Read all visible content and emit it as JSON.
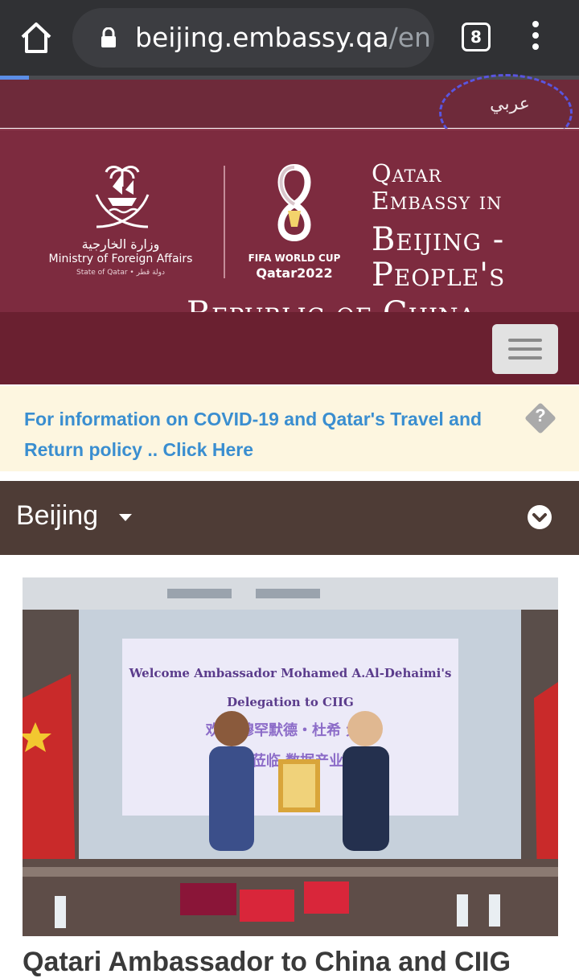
{
  "browser": {
    "url_host": "beijing.embassy.qa",
    "url_path": "/en",
    "tab_count": "8"
  },
  "header": {
    "language_link": "عربي",
    "mofa_arabic": "وزارة الخارجية",
    "mofa_english": "Ministry of Foreign Affairs",
    "mofa_state": "State of Qatar • دولة قطر",
    "worldcup_line1": "FIFA WORLD CUP",
    "worldcup_line2": "Qatar2022",
    "title_line1": "Qatar",
    "title_line2": "Embassy in",
    "title_line3": "Beijing -",
    "title_line4": "People's",
    "title_line5": "Republic of China"
  },
  "notice": {
    "text": "For information on COVID-19 and Qatar's Travel and Return policy .. Click Here",
    "help_icon": "?"
  },
  "city_selector": {
    "label": "Beijing"
  },
  "article": {
    "banner_line1": "Welcome Ambassador Mohamed A.Al-Dehaimi's",
    "banner_line2": "Delegation to CIIG",
    "banner_line3": "欢迎 穆罕默德・杜希 大使",
    "banner_line4": "莅临 数据产业集团",
    "title": "Qatari Ambassador to China and CIIG"
  },
  "colors": {
    "maroon": "#7d2b3f",
    "nav": "#6a2030",
    "notice_bg": "#fdf6e0",
    "notice_text": "#3a8ed0",
    "city_bg": "#4e3c36"
  }
}
